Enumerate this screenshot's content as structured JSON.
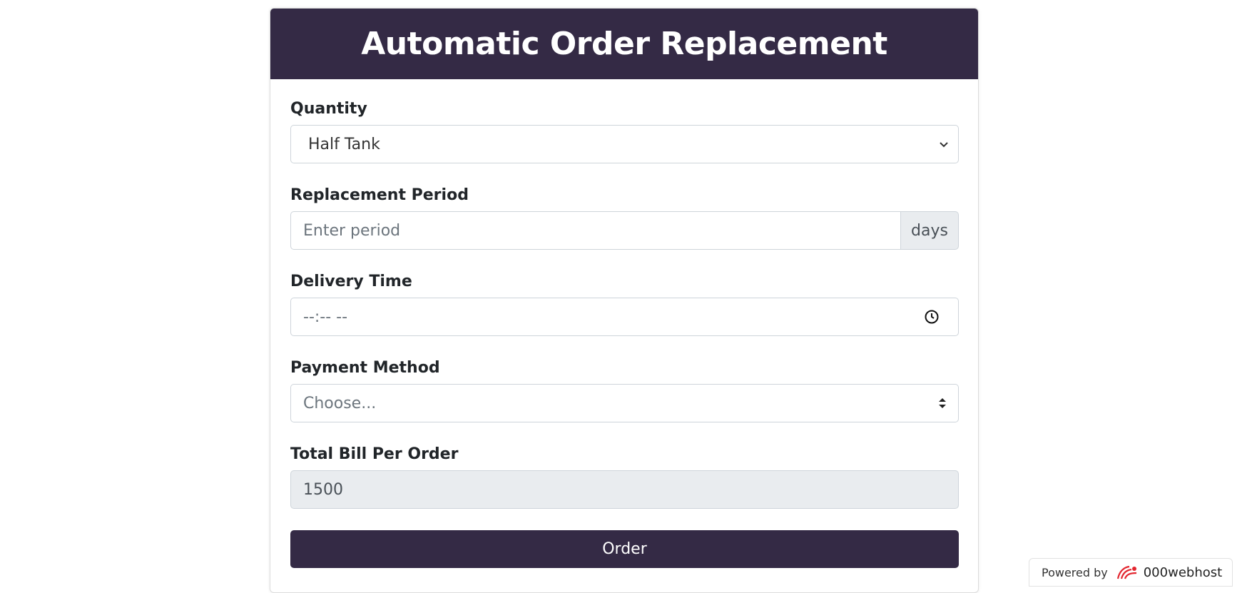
{
  "header": {
    "title": "Automatic Order Replacement"
  },
  "form": {
    "quantity": {
      "label": "Quantity",
      "value": "Half Tank"
    },
    "replacement_period": {
      "label": "Replacement Period",
      "placeholder": "Enter period",
      "addon": "days"
    },
    "delivery_time": {
      "label": "Delivery Time",
      "placeholder": "--:-- --"
    },
    "payment_method": {
      "label": "Payment Method",
      "value": "Choose..."
    },
    "total_bill": {
      "label": "Total Bill Per Order",
      "value": "1500"
    },
    "submit_label": "Order"
  },
  "badge": {
    "powered_by": "Powered by",
    "brand": "000webhost"
  },
  "colors": {
    "accent": "#342a45",
    "brand_logo": "#e3262f"
  },
  "icons": {
    "quantity": "chevron-down-icon",
    "delivery_time": "clock-icon",
    "payment_method": "sort-arrows-icon",
    "badge": "webhost-logo-icon"
  }
}
